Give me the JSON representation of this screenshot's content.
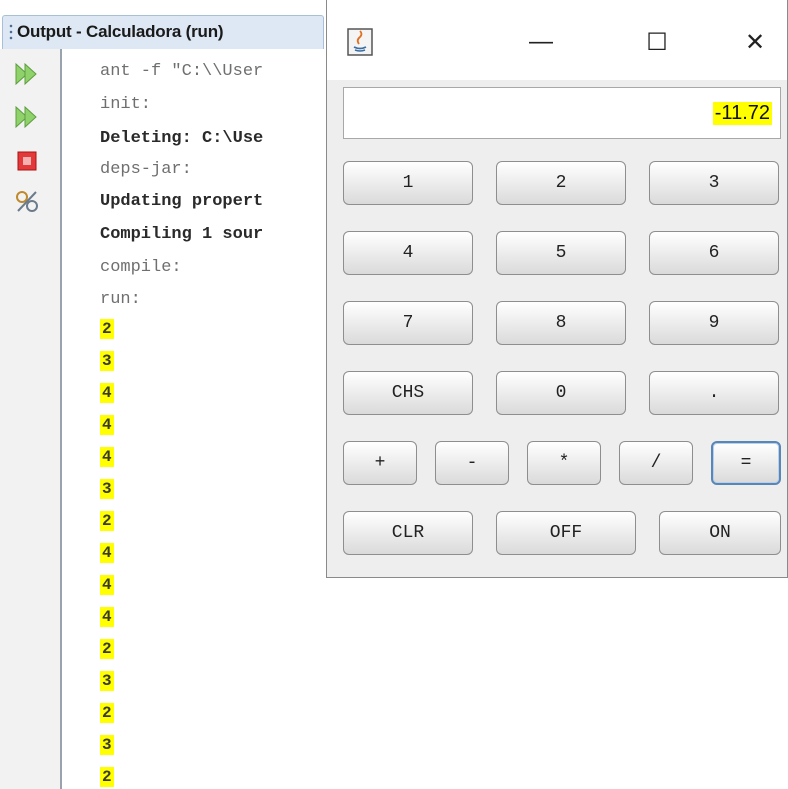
{
  "output_tab": {
    "title": "Output - Calculadora (run)"
  },
  "console": {
    "lines": [
      {
        "text": "ant -f \"C:\\\\User",
        "style": "gray"
      },
      {
        "text": "init:",
        "style": "gray"
      },
      {
        "text": "Deleting: C:\\Use",
        "style": "dark"
      },
      {
        "text": "deps-jar:",
        "style": "gray"
      },
      {
        "text": "Updating propert",
        "style": "dark"
      },
      {
        "text": "Compiling 1 sour",
        "style": "dark"
      },
      {
        "text": "compile:",
        "style": "gray"
      },
      {
        "text": "run:",
        "style": "gray"
      }
    ],
    "outputs": [
      "2",
      "3",
      "4",
      "4",
      "4",
      "3",
      "2",
      "4",
      "4",
      "4",
      "2",
      "3",
      "2",
      "3",
      "2"
    ]
  },
  "gutter_icons": [
    "rerun-icon",
    "rerun-with-params-icon",
    "stop-icon",
    "settings-icon"
  ],
  "calculator": {
    "window_controls": {
      "minimize": "—",
      "maximize": "☐",
      "close": "✕"
    },
    "display_value": "-11.72",
    "keys": {
      "one": "1",
      "two": "2",
      "three": "3",
      "four": "4",
      "five": "5",
      "six": "6",
      "seven": "7",
      "eight": "8",
      "nine": "9",
      "chs": "CHS",
      "zero": "0",
      "dot": ".",
      "plus": "+",
      "minus": "-",
      "times": "*",
      "divide": "/",
      "equals": "=",
      "clr": "CLR",
      "off": "OFF",
      "on": "ON"
    }
  },
  "colors": {
    "highlight": "#ffff00",
    "tab_bg": "#dde8f4",
    "focus_border": "#5a86b6"
  }
}
